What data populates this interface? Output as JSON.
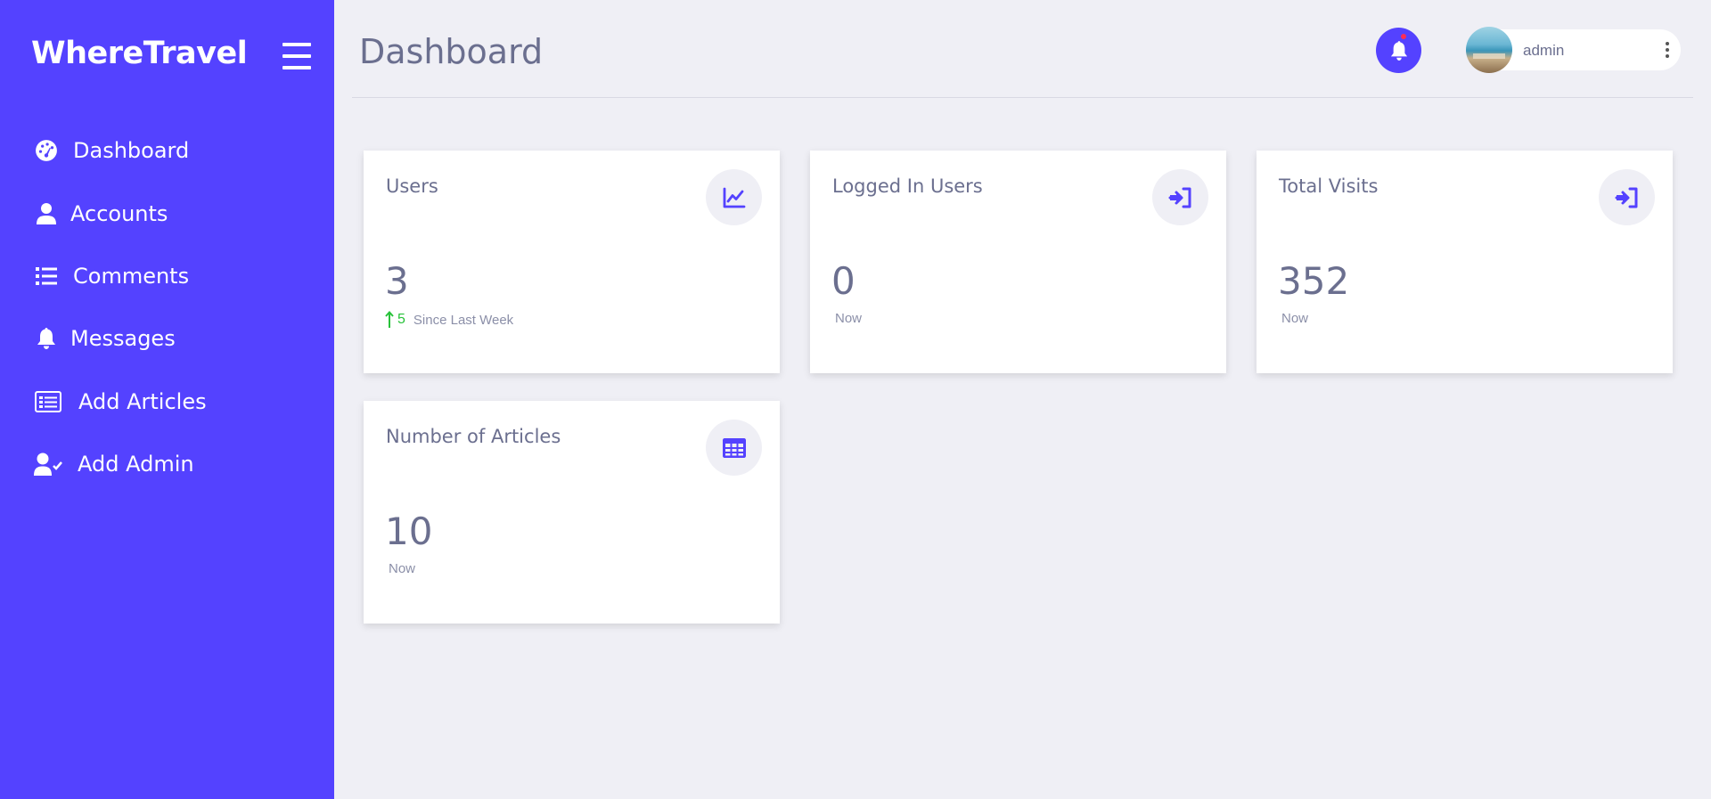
{
  "brand": "WhereTravel",
  "sidebar": {
    "items": [
      {
        "label": "Dashboard",
        "icon": "gauge-icon"
      },
      {
        "label": "Accounts",
        "icon": "user-icon"
      },
      {
        "label": "Comments",
        "icon": "list-icon"
      },
      {
        "label": "Messages",
        "icon": "bell-icon"
      },
      {
        "label": "Add Articles",
        "icon": "newspaper-icon"
      },
      {
        "label": "Add Admin",
        "icon": "user-check-icon"
      }
    ]
  },
  "header": {
    "title": "Dashboard",
    "user": {
      "name": "admin"
    }
  },
  "cards": [
    {
      "title": "Users",
      "value": "3",
      "trend": "5",
      "note": "Since Last Week",
      "icon": "line-chart-icon"
    },
    {
      "title": "Logged In Users",
      "value": "0",
      "note": "Now",
      "icon": "sign-in-icon"
    },
    {
      "title": "Total Visits",
      "value": "352",
      "note": "Now",
      "icon": "sign-in-icon"
    },
    {
      "title": "Number of Articles",
      "value": "10",
      "note": "Now",
      "icon": "table-icon"
    }
  ],
  "colors": {
    "accent": "#5442ff",
    "background": "#efeff5",
    "text": "#6b6f8f",
    "trend_up": "#28c23a",
    "notification_dot": "#ff2d55"
  }
}
